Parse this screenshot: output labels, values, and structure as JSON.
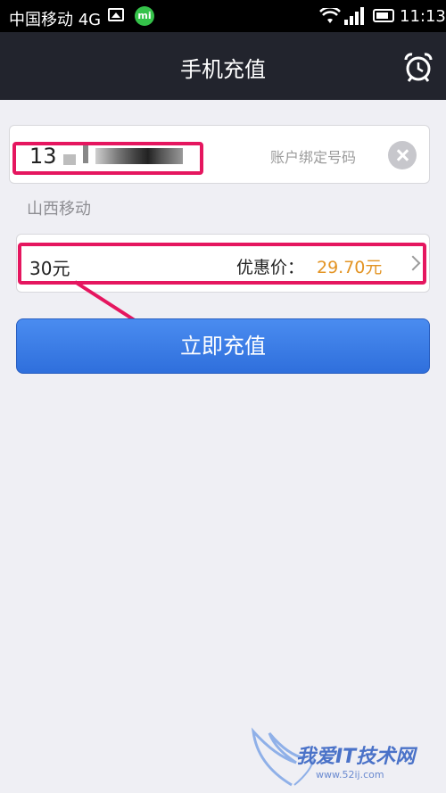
{
  "status_bar": {
    "carrier": "中国移动 4G",
    "mi_badge": "mi",
    "time": "11:13"
  },
  "nav": {
    "title": "手机充值",
    "right_icon": "alarm-clock-icon"
  },
  "phone": {
    "number_visible": "13",
    "hint": "账户绑定号码",
    "clear_icon": "clear-icon"
  },
  "carrier_name": "山西移动",
  "amount": {
    "value": "30元",
    "discount_label": "优惠价：",
    "discount_price": "29.70元",
    "price_color": "#e39424"
  },
  "button": {
    "label": "立即充值",
    "color": "#3a7ce8"
  },
  "highlight_color": "#e5165f",
  "watermark": {
    "text": "我爱IT技术网",
    "url": "www.52ij.com"
  }
}
